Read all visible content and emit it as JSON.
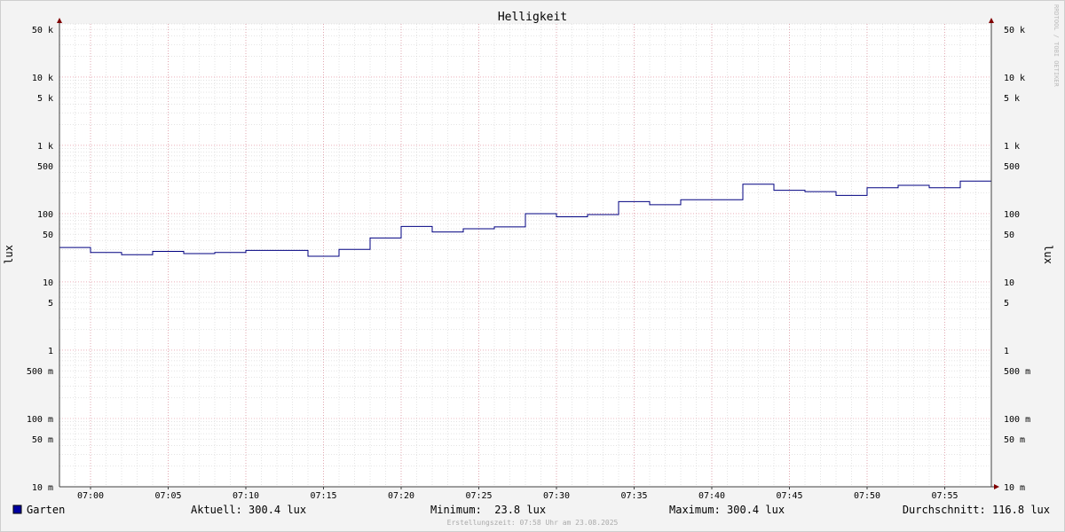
{
  "chart_data": {
    "type": "line",
    "title": "Helligkeit",
    "ylabel": "lux",
    "ylabel_right": "lux",
    "y_scale": "log",
    "ylim": [
      0.01,
      60000
    ],
    "xlim": [
      "06:58:00",
      "07:58:00"
    ],
    "x_tick_labels": [
      "07:00",
      "07:05",
      "07:10",
      "07:15",
      "07:20",
      "07:25",
      "07:30",
      "07:35",
      "07:40",
      "07:45",
      "07:50",
      "07:55"
    ],
    "y_ticks": [
      {
        "value": 50000,
        "label": "50 k"
      },
      {
        "value": 10000,
        "label": "10 k"
      },
      {
        "value": 5000,
        "label": "5 k"
      },
      {
        "value": 1000,
        "label": "1 k"
      },
      {
        "value": 500,
        "label": "500"
      },
      {
        "value": 100,
        "label": "100"
      },
      {
        "value": 50,
        "label": "50"
      },
      {
        "value": 10,
        "label": "10"
      },
      {
        "value": 5,
        "label": "5"
      },
      {
        "value": 1,
        "label": "1"
      },
      {
        "value": 0.5,
        "label": "500 m"
      },
      {
        "value": 0.1,
        "label": "100 m"
      },
      {
        "value": 0.05,
        "label": "50 m"
      },
      {
        "value": 0.01,
        "label": "10 m"
      }
    ],
    "grid": true,
    "series": [
      {
        "name": "Garten",
        "step": true,
        "x": [
          "06:58",
          "07:00",
          "07:02",
          "07:04",
          "07:06",
          "07:08",
          "07:10",
          "07:12",
          "07:14",
          "07:16",
          "07:18",
          "07:20",
          "07:22",
          "07:24",
          "07:26",
          "07:28",
          "07:30",
          "07:32",
          "07:34",
          "07:36",
          "07:38",
          "07:40",
          "07:42",
          "07:44",
          "07:46",
          "07:48",
          "07:50",
          "07:52",
          "07:54",
          "07:56"
        ],
        "values": [
          32,
          27,
          25,
          28,
          26,
          27,
          29,
          29,
          23.8,
          30,
          44,
          65,
          54,
          60,
          64,
          100,
          90,
          97,
          150,
          135,
          160,
          160,
          270,
          220,
          210,
          185,
          240,
          260,
          240,
          300.4
        ]
      }
    ],
    "colors": {
      "series": "#000080",
      "legend_swatch": "#0000a0",
      "grid_major": "#e08090",
      "grid_minor": "#c8c8c8",
      "arrow": "#800000"
    }
  },
  "legend": {
    "label": "Garten"
  },
  "stats": {
    "current": "Aktuell: 300.4 lux",
    "minimum": "Minimum:  23.8 lux",
    "maximum": "Maximum: 300.4 lux",
    "average": "Durchschnitt: 116.8 lux"
  },
  "footer": "Erstellungszeit: 07:58 Uhr am 23.08.2025",
  "watermark": "RRDTOOL / TOBI OETIKER"
}
